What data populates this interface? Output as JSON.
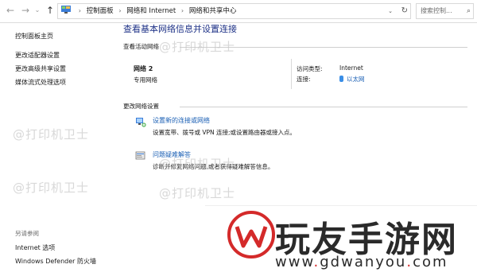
{
  "address_bar": {
    "back_icon": "back-arrow-icon",
    "forward_icon": "forward-arrow-icon",
    "recent_icon": "chevron-down-icon",
    "up_icon": "up-arrow-icon",
    "breadcrumbs": [
      "控制面板",
      "网络和 Internet",
      "网络和共享中心"
    ],
    "search_placeholder": "搜索控制..."
  },
  "sidebar": {
    "items": [
      "控制面板主页",
      "更改适配器设置",
      "更改高级共享设置",
      "媒体流式处理选项"
    ],
    "see_also_heading": "另请参阅",
    "see_also": [
      "Internet 选项",
      "Windows Defender 防火墙"
    ]
  },
  "main": {
    "title": "查看基本网络信息并设置连接",
    "active_networks_label": "查看活动网络",
    "network": {
      "name": "网络 2",
      "profile": "专用网络",
      "access_type_label": "访问类型:",
      "access_type_value": "Internet",
      "connections_label": "连接:",
      "connections_value": "以太网"
    },
    "change_settings_label": "更改网络设置",
    "tasks": [
      {
        "title": "设置新的连接或网络",
        "desc": "设置宽带、拨号或 VPN 连接;或设置路由器或接入点。",
        "icon": "network-setup-icon"
      },
      {
        "title": "问题疑难解答",
        "desc": "诊断并修复网络问题,或者获得疑难解答信息。",
        "icon": "troubleshoot-icon"
      }
    ]
  },
  "watermark": {
    "text": "@打印机卫士"
  },
  "promo": {
    "brand": "玩友手游网",
    "domain_parts": [
      "www",
      ".",
      "gdwanyou",
      ".",
      "com"
    ]
  },
  "colors": {
    "link": "#1a5fb4",
    "title": "#1e3287",
    "accent_red": "#d42a2a"
  }
}
